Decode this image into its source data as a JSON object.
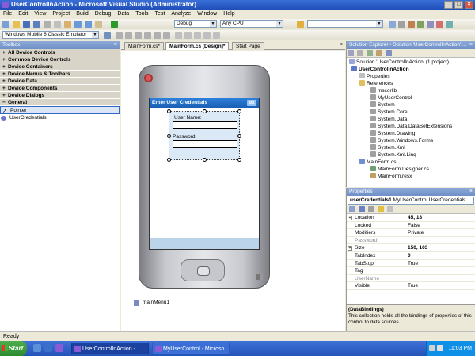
{
  "window": {
    "title": "UserControlInAction - Microsoft Visual Studio (Administrator)",
    "min": "_",
    "max": "□",
    "close": "×"
  },
  "menu": [
    "File",
    "Edit",
    "View",
    "Project",
    "Build",
    "Debug",
    "Data",
    "Tools",
    "Test",
    "Analyze",
    "Window",
    "Help"
  ],
  "toolbar": {
    "config": "Debug",
    "platform": "Any CPU",
    "emulator": "Windows Mobile 6 Classic Emulator"
  },
  "toolbox": {
    "title": "Toolbox",
    "categories": [
      "All Device Controls",
      "Common Device Controls",
      "Device Containers",
      "Device Menus & Toolbars",
      "Device Data",
      "Device Components",
      "Device Dialogs",
      "General"
    ],
    "items": [
      "Pointer",
      "UserCredentials"
    ]
  },
  "tabs": [
    "MainForm.cs*",
    "MainForm.cs [Design]*",
    "Start Page"
  ],
  "designer": {
    "form_title": "Enter User Credentials",
    "ok": "ok",
    "username_label": "User Name:",
    "password_label": "Password:",
    "component": "mainMenu1"
  },
  "solution": {
    "title": "Solution Explorer - Solution 'UserControlInAction' ...",
    "items": [
      "Solution 'UserControlInAction' (1 project)",
      "UserControlInAction",
      "Properties",
      "References",
      "mscorlib",
      "MyUserControl",
      "System",
      "System.Core",
      "System.Data",
      "System.Data.DataSetExtensions",
      "System.Drawing",
      "System.Windows.Forms",
      "System.Xml",
      "System.Xml.Linq",
      "MainForm.cs",
      "MainForm.Designer.cs",
      "MainForm.resx"
    ]
  },
  "properties": {
    "title": "Properties",
    "object_name": "userCredentials1",
    "object_type": "MyUserControl.UserCredentials",
    "rows": [
      {
        "name": "Location",
        "value": "45, 13",
        "bold": true,
        "expand": true
      },
      {
        "name": "Locked",
        "value": "False"
      },
      {
        "name": "Modifiers",
        "value": "Private"
      },
      {
        "name": "Password",
        "value": "",
        "gray": true
      },
      {
        "name": "Size",
        "value": "150, 103",
        "bold": true,
        "expand": true
      },
      {
        "name": "TabIndex",
        "value": "0",
        "bold": true
      },
      {
        "name": "TabStop",
        "value": "True"
      },
      {
        "name": "Tag",
        "value": ""
      },
      {
        "name": "UserName",
        "value": "",
        "gray": true
      },
      {
        "name": "Visible",
        "value": "True"
      }
    ],
    "desc_title": "(DataBindings)",
    "desc_text": "This collection holds all the bindings of properties of this control to data sources."
  },
  "status": "Ready",
  "taskbar": {
    "start": "Start",
    "tasks": [
      "UserControlInAction -...",
      "MyUserControl - Microso..."
    ],
    "time": "11:03 PM"
  },
  "colors": {
    "titlebar": "#1f4fb8",
    "taskbar": "#2453b8",
    "start": "#2d8a2d",
    "formtitle": "#1a5fb4"
  }
}
